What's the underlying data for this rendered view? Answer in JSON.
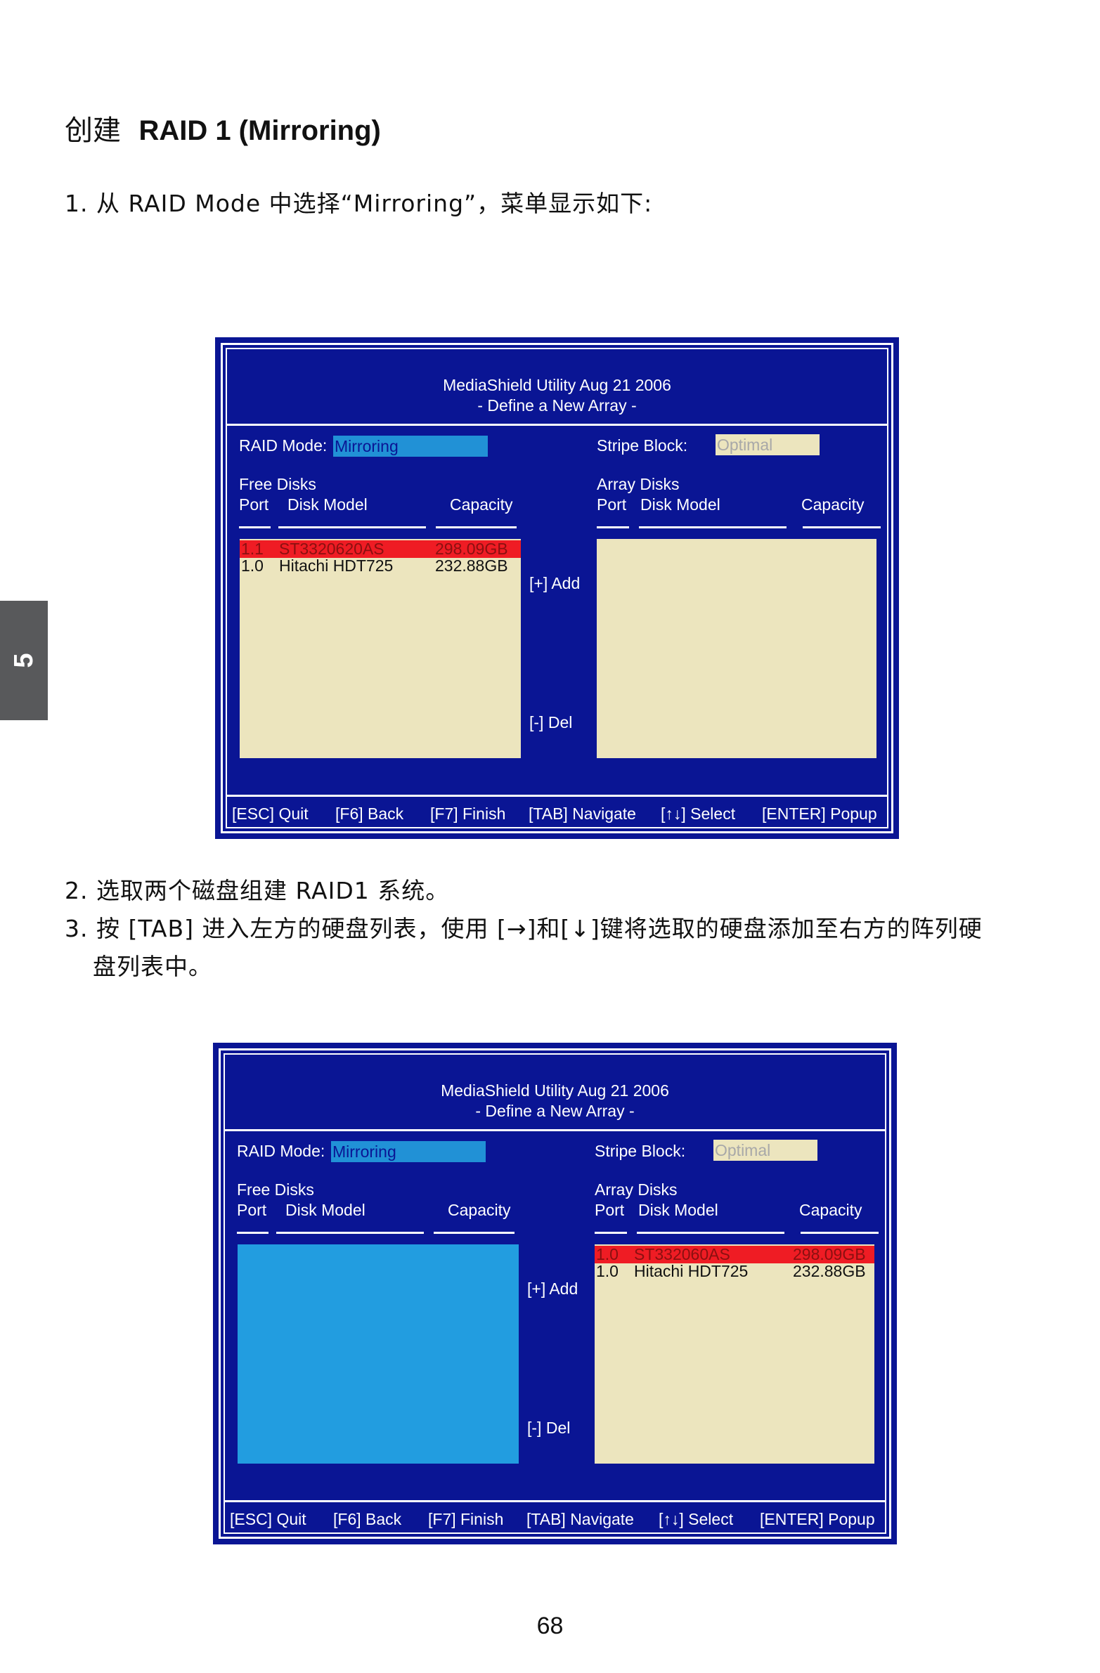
{
  "heading": {
    "prefix": "创建",
    "title": "RAID 1 (Mirroring)"
  },
  "steps": {
    "step1": "1. 从 RAID Mode 中选择“Mirroring”，菜单显示如下:",
    "step2": "2. 选取两个磁盘组建 RAID1 系统。",
    "step3_line1": "3. 按 [TAB] 进入左方的硬盘列表，使用 [→]和[↓]键将选取的硬盘添加至右方的阵列硬",
    "step3_line2": "盘列表中。"
  },
  "side_tab": "5",
  "page_number": "68",
  "screen1": {
    "title": "MediaShield Utility   Aug 21 2006",
    "subtitle": "- Define a New Array -",
    "raid_mode_label": "RAID Mode:",
    "raid_mode_value": "Mirroring",
    "stripe_label": "Stripe Block:",
    "stripe_value": "Optimal",
    "free_title": "Free Disks",
    "array_title": "Array Disks",
    "col_port": "Port",
    "col_model": "Disk Model",
    "col_capacity": "Capacity",
    "add_label": "[+] Add",
    "del_label": "[-] Del",
    "free_disks": [
      {
        "port": "1.1",
        "model": "ST3320620AS",
        "capacity": "298.09GB",
        "selected": true
      },
      {
        "port": "1.0",
        "model": "Hitachi HDT725",
        "capacity": "232.88GB",
        "selected": false
      }
    ],
    "array_disks": [],
    "footer": {
      "esc": "[ESC] Quit",
      "f6": "[F6] Back",
      "f7": "[F7] Finish",
      "tab": "[TAB] Navigate",
      "select": "[↑↓] Select",
      "enter": "[ENTER] Popup"
    },
    "colors": {
      "background": "#0a1594",
      "field_blue": "#229de0",
      "field_beige": "#ece5be",
      "highlight": "#ef1c24"
    }
  },
  "screen2": {
    "title": "MediaShield Utility   Aug 21 2006",
    "subtitle": "- Define a New Array -",
    "raid_mode_label": "RAID Mode:",
    "raid_mode_value": "Mirroring",
    "stripe_label": "Stripe Block:",
    "stripe_value": "Optimal",
    "free_title": "Free Disks",
    "array_title": "Array Disks",
    "col_port": "Port",
    "col_model": "Disk Model",
    "col_capacity": "Capacity",
    "add_label": "[+] Add",
    "del_label": "[-] Del",
    "free_disks": [],
    "array_disks": [
      {
        "port": "1.0",
        "model": "ST332060AS",
        "capacity": "298.09GB",
        "selected": true
      },
      {
        "port": "1.0",
        "model": "Hitachi HDT725",
        "capacity": "232.88GB",
        "selected": false
      }
    ],
    "footer": {
      "esc": "[ESC] Quit",
      "f6": "[F6] Back",
      "f7": "[F7] Finish",
      "tab": "[TAB] Navigate",
      "select": "[↑↓] Select",
      "enter": "[ENTER] Popup"
    },
    "colors": {
      "background": "#0a1594",
      "field_blue": "#229de0",
      "field_beige": "#ece5be",
      "highlight": "#ef1c24"
    }
  }
}
